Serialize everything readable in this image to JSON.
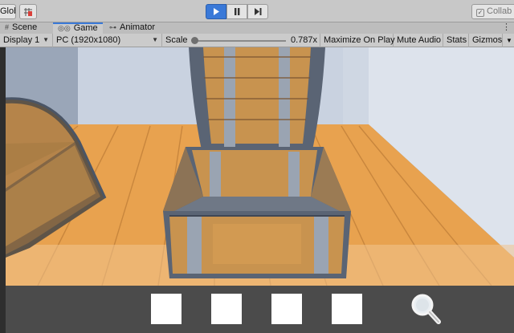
{
  "toolbar": {
    "global_label": "Global",
    "play_icon": "play-icon",
    "pause_icon": "pause-icon",
    "step_icon": "step-icon",
    "collab_label": "Collab"
  },
  "tabs": [
    {
      "label": "Scene",
      "icon": "hash-icon"
    },
    {
      "label": "Game",
      "icon": "gamepad-icon"
    },
    {
      "label": "Animator",
      "icon": "animator-icon"
    }
  ],
  "game_bar": {
    "display": "Display 1",
    "resolution": "PC (1920x1080)",
    "scale_label": "Scale",
    "scale_value": "0.787x",
    "maximize_on_play": "Maximize On Play",
    "mute_audio": "Mute Audio",
    "stats": "Stats",
    "gizmos": "Gizmos"
  },
  "inventory": {
    "slot_count": 4,
    "magnifier_icon": "magnifier-icon"
  },
  "colors": {
    "accent": "#3a79d8",
    "floor": "#e8a24f",
    "wall": "#c9d2e0",
    "inventory_bg": "#4b4b4b"
  }
}
